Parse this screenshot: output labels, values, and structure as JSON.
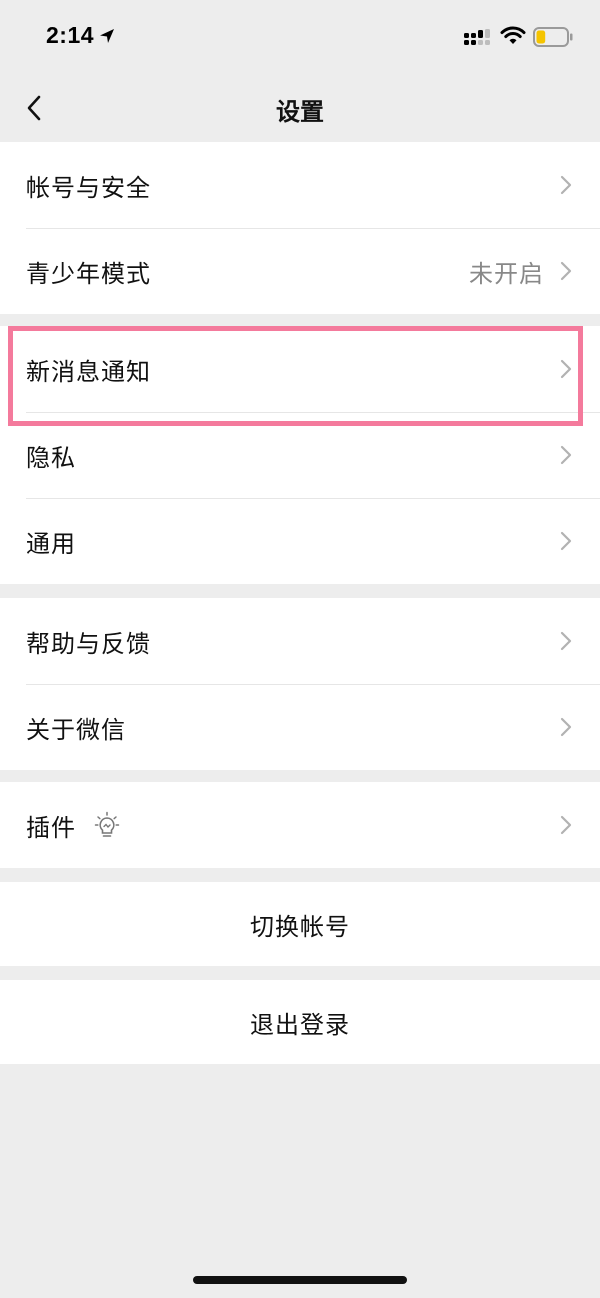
{
  "status_bar": {
    "time": "2:14"
  },
  "nav": {
    "title": "设置"
  },
  "groups": [
    {
      "items": [
        {
          "label": "帐号与安全",
          "value": ""
        },
        {
          "label": "青少年模式",
          "value": "未开启"
        }
      ]
    },
    {
      "items": [
        {
          "label": "新消息通知",
          "value": ""
        },
        {
          "label": "隐私",
          "value": ""
        },
        {
          "label": "通用",
          "value": ""
        }
      ]
    },
    {
      "items": [
        {
          "label": "帮助与反馈",
          "value": ""
        },
        {
          "label": "关于微信",
          "value": ""
        }
      ]
    },
    {
      "items": [
        {
          "label": "插件",
          "value": "",
          "icon": "lightbulb-icon"
        }
      ]
    }
  ],
  "actions": {
    "switch_account": "切换帐号",
    "logout": "退出登录"
  },
  "colors": {
    "background": "#ededed",
    "highlight": "#f47a9c",
    "battery_level": "#f5c400"
  },
  "battery": {
    "level_fraction": 0.3
  }
}
